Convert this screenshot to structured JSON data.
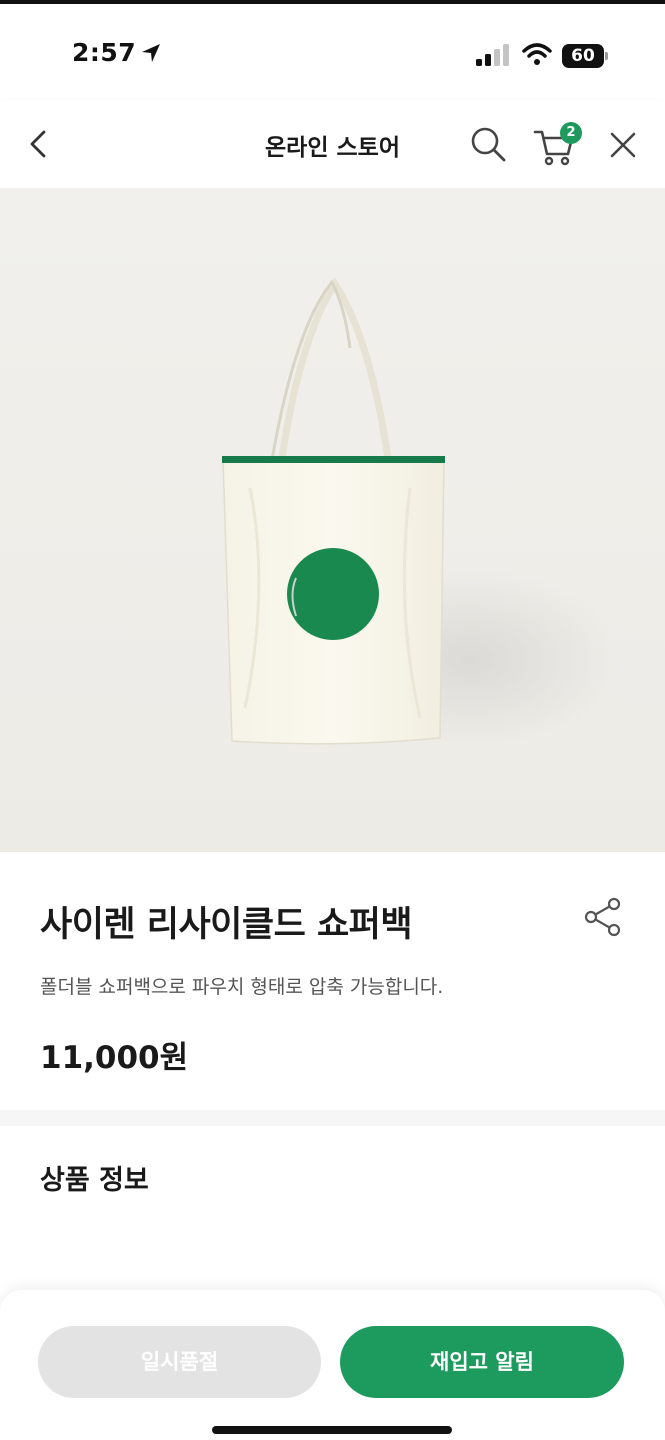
{
  "status_bar": {
    "time": "2:57",
    "battery": "60"
  },
  "nav": {
    "title": "온라인 스토어",
    "cart_count": "2"
  },
  "product": {
    "name": "사이렌 리사이클드 쇼퍼백",
    "description": "폴더블 쇼퍼백으로 파우치 형태로 압축 가능합니다.",
    "price": "11,000원"
  },
  "details": {
    "title": "상품 정보"
  },
  "actions": {
    "sold_out_label": "일시품절",
    "restock_label": "재입고 알림"
  },
  "colors": {
    "brand_green": "#1d9a5d",
    "disabled_gray": "#e3e3e3"
  }
}
